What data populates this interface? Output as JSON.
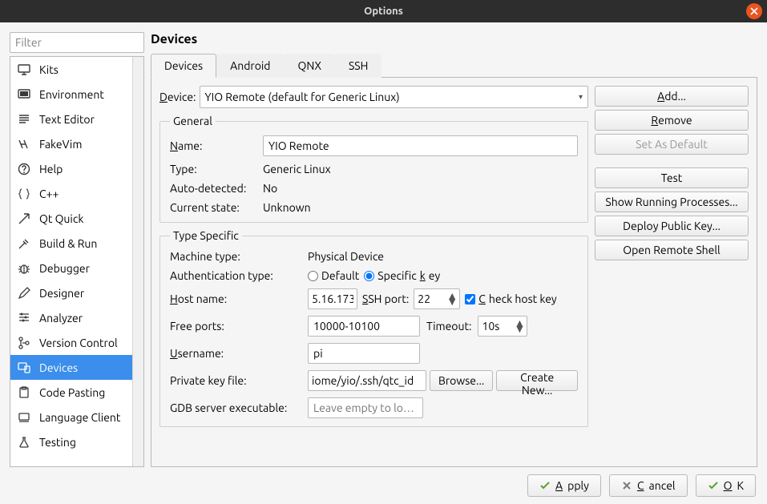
{
  "window": {
    "title": "Options"
  },
  "filter": {
    "placeholder": "Filter"
  },
  "categories": [
    {
      "label": "Kits"
    },
    {
      "label": "Environment"
    },
    {
      "label": "Text Editor"
    },
    {
      "label": "FakeVim"
    },
    {
      "label": "Help"
    },
    {
      "label": "C++"
    },
    {
      "label": "Qt Quick"
    },
    {
      "label": "Build & Run"
    },
    {
      "label": "Debugger"
    },
    {
      "label": "Designer"
    },
    {
      "label": "Analyzer"
    },
    {
      "label": "Version Control"
    },
    {
      "label": "Devices"
    },
    {
      "label": "Code Pasting"
    },
    {
      "label": "Language Client"
    },
    {
      "label": "Testing"
    }
  ],
  "main_title": "Devices",
  "tabs": [
    {
      "label": "Devices"
    },
    {
      "label": "Android"
    },
    {
      "label": "QNX"
    },
    {
      "label": "SSH"
    }
  ],
  "device_row": {
    "label": "Device:",
    "value": "YIO Remote (default for Generic Linux)"
  },
  "side_buttons": {
    "add": "Add...",
    "remove": "Remove",
    "default": "Set As Default",
    "test": "Test",
    "procs": "Show Running Processes...",
    "deploy": "Deploy Public Key...",
    "shell": "Open Remote Shell"
  },
  "general": {
    "legend": "General",
    "name_label": "Name:",
    "name_val": "YIO Remote",
    "type_label": "Type:",
    "type_val": "Generic Linux",
    "auto_label": "Auto-detected:",
    "auto_val": "No",
    "state_label": "Current state:",
    "state_val": "Unknown"
  },
  "ts": {
    "legend": "Type Specific",
    "machine_label": "Machine type:",
    "machine_val": "Physical Device",
    "auth_label": "Authentication type:",
    "auth_default": "Default",
    "auth_key": "Specific key",
    "host_label": "Host name:",
    "host_val": "5.16.173",
    "ssh_label": "SSH port:",
    "ssh_val": "22",
    "check_host": "Check host key",
    "free_label": "Free ports:",
    "free_val": "10000-10100",
    "timeout_label": "Timeout:",
    "timeout_val": "10s",
    "user_label": "Username:",
    "user_val": "pi",
    "key_label": "Private key file:",
    "key_val": "iome/yio/.ssh/qtc_id",
    "browse": "Browse...",
    "create": "Create New...",
    "gdb_label": "GDB server executable:",
    "gdb_placeholder": "Leave empty to lo…"
  },
  "footer": {
    "apply": "Apply",
    "cancel": "Cancel",
    "ok": "OK"
  }
}
